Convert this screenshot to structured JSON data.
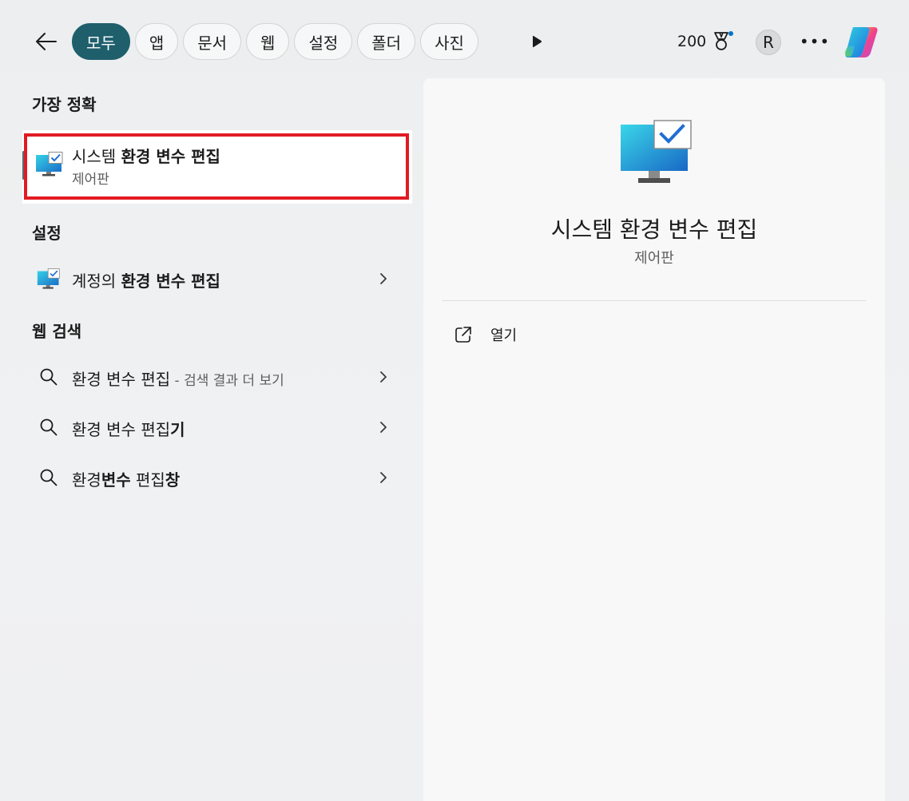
{
  "filters": {
    "tabs": [
      {
        "label": "모두",
        "active": true
      },
      {
        "label": "앱"
      },
      {
        "label": "문서"
      },
      {
        "label": "웹"
      },
      {
        "label": "설정"
      },
      {
        "label": "폴더"
      },
      {
        "label": "사진"
      }
    ]
  },
  "header": {
    "points": "200",
    "avatar_initial": "R",
    "more_label": "•••"
  },
  "best_match": {
    "section_title": "가장 정확",
    "title_plain": "시스템 ",
    "title_bold": "환경 변수 편집",
    "subtitle": "제어판"
  },
  "settings": {
    "section_title": "설정",
    "item": {
      "plain": "계정의 ",
      "bold": "환경 변수 편집"
    }
  },
  "web_search": {
    "section_title": "웹 검색",
    "items": [
      {
        "plain": "환경 변수 편집",
        "bold": "",
        "suffix": " - 검색 결과 더 보기"
      },
      {
        "plain": "환경 변수 편집",
        "bold": "기",
        "suffix": ""
      },
      {
        "plain": "환경",
        "bold": "변수",
        "plain2": " 편집",
        "bold2": "창",
        "suffix": ""
      }
    ]
  },
  "preview": {
    "title": "시스템 환경 변수 편집",
    "subtitle": "제어판",
    "open_label": "열기"
  },
  "colors": {
    "active_tab": "#1f5f6c",
    "highlight_border": "#e11b22",
    "accent_dot": "#0a72c6"
  },
  "icons": {
    "back": "arrow-left-icon",
    "play": "play-icon",
    "medal": "medal-icon",
    "copilot": "copilot-icon",
    "monitor": "monitor-check-icon",
    "search": "search-icon",
    "chevron": "chevron-right-icon",
    "open": "open-external-icon"
  }
}
